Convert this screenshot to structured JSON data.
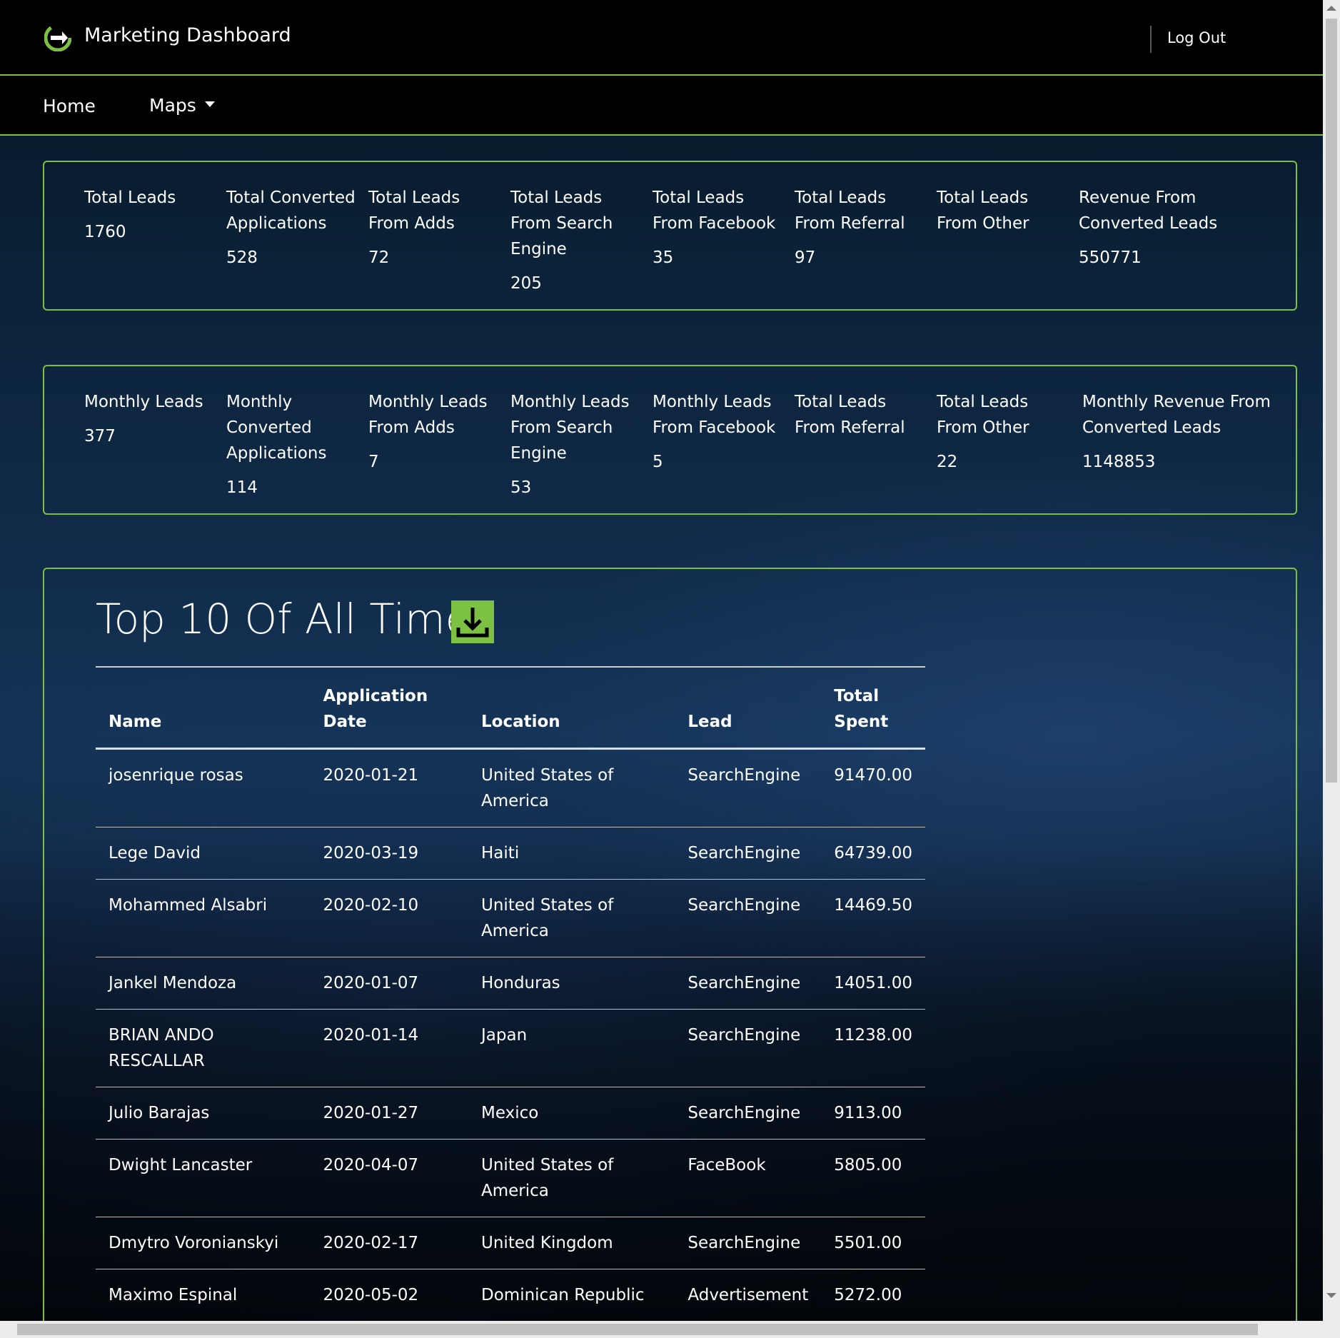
{
  "header": {
    "app_title": "Marketing Dashboard",
    "logout_label": "Log Out",
    "logo_icon": "logo-icon"
  },
  "nav": {
    "home_label": "Home",
    "maps_label": "Maps"
  },
  "totals": [
    {
      "label": "Total Leads",
      "value": "1760"
    },
    {
      "label": "Total Converted Applications",
      "value": "528"
    },
    {
      "label": "Total Leads From Adds",
      "value": "72"
    },
    {
      "label": "Total Leads From Search Engine",
      "value": "205"
    },
    {
      "label": "Total Leads From Facebook",
      "value": "35"
    },
    {
      "label": "Total Leads From Referral",
      "value": "97"
    },
    {
      "label": "Total Leads From Other",
      "value": ""
    },
    {
      "label": "Revenue From Converted Leads",
      "value": "550771"
    }
  ],
  "monthly": [
    {
      "label": "Monthly Leads",
      "value": "377"
    },
    {
      "label": "Monthly Converted Applications",
      "value": "114"
    },
    {
      "label": "Monthly Leads From Adds",
      "value": "7"
    },
    {
      "label": "Monthly Leads From Search Engine",
      "value": "53"
    },
    {
      "label": "Monthly Leads From Facebook",
      "value": "5"
    },
    {
      "label": "Total Leads From Referral",
      "value": ""
    },
    {
      "label": "Total Leads From Other",
      "value": "22"
    },
    {
      "label": "Monthly Revenue From Converted Leads",
      "value": "1148853"
    }
  ],
  "top10": {
    "title": "Top 10 Of All Time",
    "download_icon": "download-icon",
    "columns": [
      "Name",
      "Application Date",
      "Location",
      "Lead",
      "Total Spent"
    ],
    "rows": [
      [
        "josenrique rosas",
        "2020-01-21",
        "United States of America",
        "SearchEngine",
        "91470.00"
      ],
      [
        "Lege David",
        "2020-03-19",
        "Haiti",
        "SearchEngine",
        "64739.00"
      ],
      [
        "Mohammed Alsabri",
        "2020-02-10",
        "United States of America",
        "SearchEngine",
        "14469.50"
      ],
      [
        "Jankel Mendoza",
        "2020-01-07",
        "Honduras",
        "SearchEngine",
        "14051.00"
      ],
      [
        "BRIAN ANDO RESCALLAR",
        "2020-01-14",
        "Japan",
        "SearchEngine",
        "11238.00"
      ],
      [
        "Julio Barajas",
        "2020-01-27",
        "Mexico",
        "SearchEngine",
        "9113.00"
      ],
      [
        "Dwight Lancaster",
        "2020-04-07",
        "United States of America",
        "FaceBook",
        "5805.00"
      ],
      [
        "Dmytro Voronianskyi",
        "2020-02-17",
        "United Kingdom",
        "SearchEngine",
        "5501.00"
      ],
      [
        "Maximo Espinal",
        "2020-05-02",
        "Dominican Republic",
        "Advertisement",
        "5272.00"
      ]
    ]
  }
}
